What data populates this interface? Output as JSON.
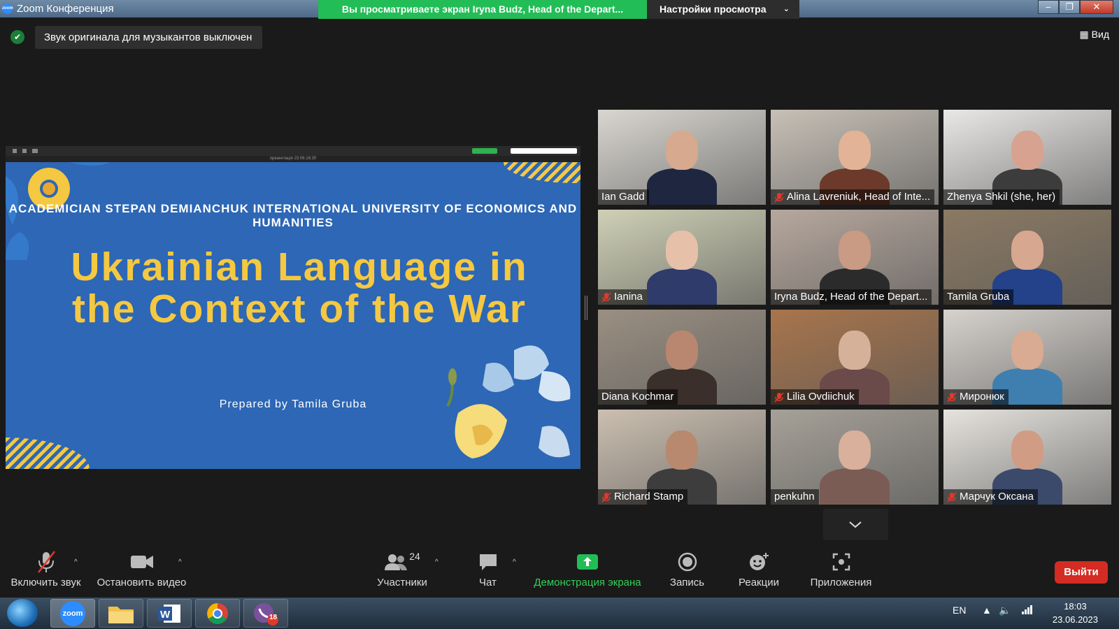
{
  "window": {
    "title": "Zoom Конференция",
    "share_banner": "Вы просматриваете экран Iryna Budz, Head of the Depart...",
    "view_options": "Настройки просмотра",
    "view_button": "Вид"
  },
  "notice": {
    "text": "Звук оригинала для музыкантов выключен"
  },
  "slide": {
    "toolbar_file": "презентація 23.06.16:30",
    "university": "ACADEMICIAN STEPAN DEMIANCHUK INTERNATIONAL UNIVERSITY OF ECONOMICS AND HUMANITIES",
    "headline": "Ukrainian Language in the Context of the War",
    "prepared_by": "Prepared by Tamila Gruba"
  },
  "participants": [
    {
      "name": "Ian Gadd",
      "muted": false,
      "active": true,
      "bg": "#d9d6d0",
      "skin": "#d7a98f",
      "shirt": "#1f2740"
    },
    {
      "name": "Alina Lavreniuk, Head of Inte...",
      "muted": true,
      "active": false,
      "bg": "#c7c0b6",
      "skin": "#e2b396",
      "shirt": "#6b3a2a"
    },
    {
      "name": "Zhenya Shkil (she, her)",
      "muted": false,
      "active": false,
      "bg": "#eae8e6",
      "skin": "#d7a390",
      "shirt": "#3c3c3c"
    },
    {
      "name": "Ianina",
      "muted": true,
      "active": false,
      "bg": "#cfd0b5",
      "skin": "#e7c0aa",
      "shirt": "#2f3b6b"
    },
    {
      "name": "Iryna Budz, Head of the Depart...",
      "muted": false,
      "active": false,
      "bg": "#b7a89e",
      "skin": "#c99a84",
      "shirt": "#2b2b2b"
    },
    {
      "name": "Tamila Gruba",
      "muted": false,
      "active": false,
      "bg": "#8b7a63",
      "skin": "#d7a790",
      "shirt": "#23428a"
    },
    {
      "name": "Diana Kochmar",
      "muted": false,
      "active": false,
      "bg": "#9a8f82",
      "skin": "#b98670",
      "shirt": "#3a2f2a"
    },
    {
      "name": "Lilia Ovdiichuk",
      "muted": true,
      "active": false,
      "bg": "#a8754c",
      "skin": "#d6b199",
      "shirt": "#6b4a4a"
    },
    {
      "name": "Миронюк",
      "muted": true,
      "active": false,
      "bg": "#d6d2cd",
      "skin": "#d8ab92",
      "shirt": "#3e7fb0"
    },
    {
      "name": "Richard Stamp",
      "muted": true,
      "active": false,
      "bg": "#cbbfb0",
      "skin": "#b8896f",
      "shirt": "#3d3d3d"
    },
    {
      "name": "penkuhn",
      "muted": false,
      "active": false,
      "bg": "#a6a198",
      "skin": "#d8b09c",
      "shirt": "#7a5c55"
    },
    {
      "name": "Марчук Оксана",
      "muted": true,
      "active": false,
      "bg": "#e6e3de",
      "skin": "#d09c84",
      "shirt": "#3b4a6a"
    }
  ],
  "toolbar": {
    "unmute_label": "Включить звук",
    "stop_video_label": "Остановить видео",
    "participants_label": "Участники",
    "participants_count": "24",
    "chat_label": "Чат",
    "share_label": "Демонстрация экрана",
    "record_label": "Запись",
    "reactions_label": "Реакции",
    "apps_label": "Приложения",
    "leave_label": "Выйти"
  },
  "taskbar": {
    "zoom_label": "zoom",
    "viber_badge": "18",
    "lang": "EN",
    "time": "18:03",
    "date": "23.06.2023"
  },
  "colors": {
    "share_green": "#22bd56",
    "leave_red": "#d42c22",
    "slide_blue": "#2d67b5",
    "slide_yellow": "#f5c842",
    "active_speaker": "#c7e24a"
  }
}
